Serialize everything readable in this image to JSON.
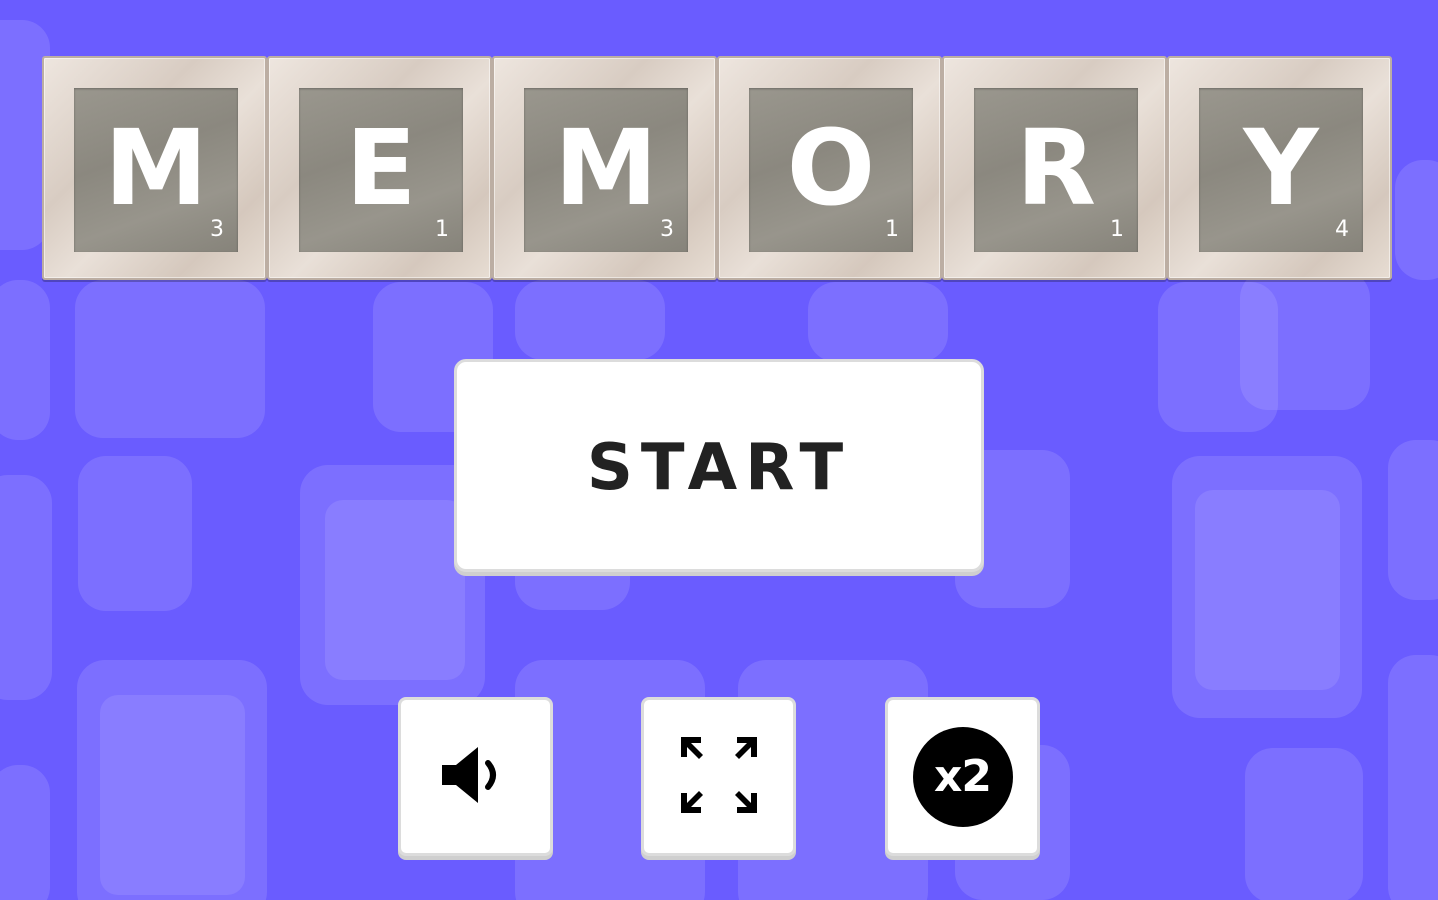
{
  "title_tiles": [
    {
      "letter": "M",
      "score": "3"
    },
    {
      "letter": "E",
      "score": "1"
    },
    {
      "letter": "M",
      "score": "3"
    },
    {
      "letter": "O",
      "score": "1"
    },
    {
      "letter": "R",
      "score": "1"
    },
    {
      "letter": "Y",
      "score": "4"
    }
  ],
  "start_button": {
    "label": "START"
  },
  "controls": {
    "sound_icon": "speaker-icon",
    "fullscreen_icon": "fullscreen-expand-icon",
    "speed_label": "x2"
  },
  "colors": {
    "background": "#6a5cff",
    "button_bg": "#ffffff",
    "tile_face": "#8f8c84"
  }
}
